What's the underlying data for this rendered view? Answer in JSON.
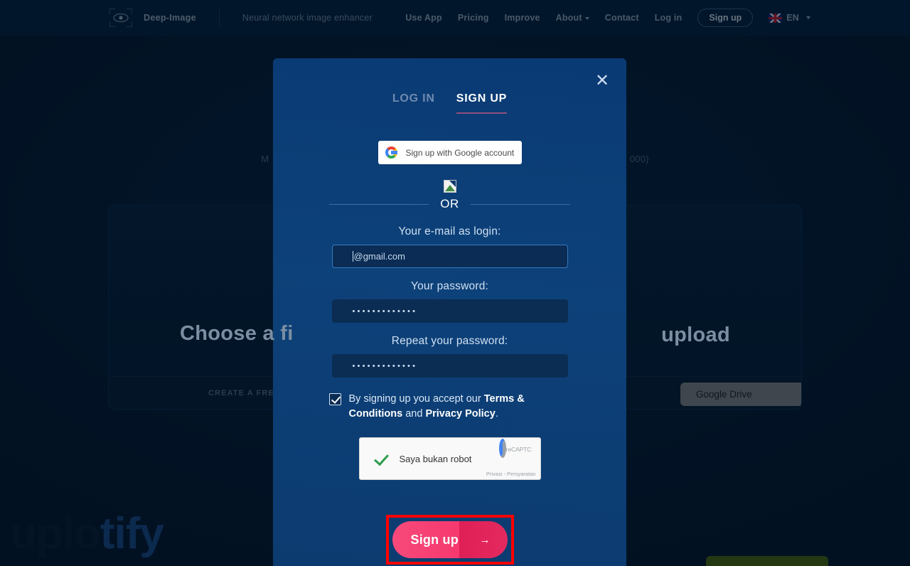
{
  "nav": {
    "brand": "Deep-Image",
    "tagline": "Neural network image enhancer",
    "links": [
      "Use App",
      "Pricing",
      "Improve",
      "About",
      "Contact",
      "Log in"
    ],
    "signup_label": "Sign up",
    "language": "EN"
  },
  "background": {
    "hero_sub_left": "M",
    "hero_sub_right": "000)",
    "drop_title_left": "Choose a fi",
    "drop_title_right": "upload",
    "footer_cta": "CREATE A FREE AC",
    "gdrive_label": "Google Drive",
    "watermark_a": "uplo",
    "watermark_b": "tify"
  },
  "modal": {
    "close_label": "✕",
    "tab_login": "LOG IN",
    "tab_signup": "SIGN UP",
    "google_button": "Sign up with Google account",
    "or_text": "OR",
    "email_label": "Your e-mail as login:",
    "email_value": "@gmail.com",
    "password_label": "Your password:",
    "password_value": "•••••••••••••",
    "repeat_label": "Repeat your password:",
    "repeat_value": "•••••••••••••",
    "terms_prefix": "By signing up you accept our ",
    "terms_link1": "Terms & Conditions",
    "terms_and": " and ",
    "terms_link2": "Privacy Policy",
    "terms_suffix": ".",
    "recaptcha_label": "Saya bukan robot",
    "recaptcha_brand": "reCAPTC",
    "recaptcha_legal": "Privasi - Persyaratan",
    "submit_label": "Sign up",
    "submit_arrow": "→"
  },
  "colors": {
    "modal_bg": "#0d4179",
    "page_bg": "#041a33",
    "accent_pink": "#f6396f",
    "highlight_red": "#ff0000",
    "tab_underline": "#8c4f7c"
  }
}
